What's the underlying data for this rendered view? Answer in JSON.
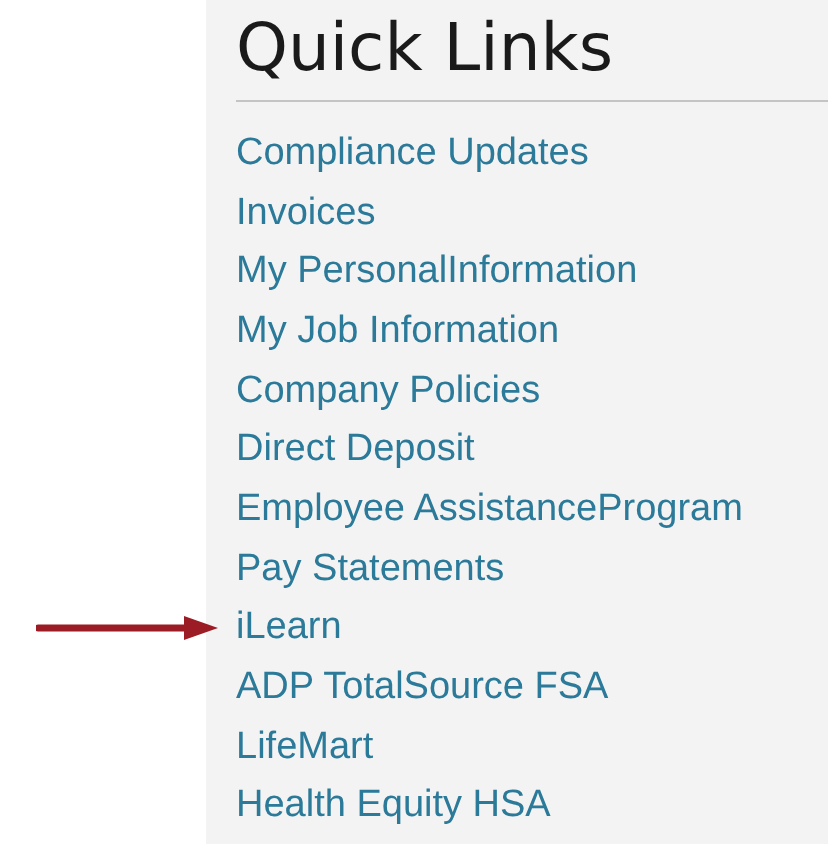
{
  "panel": {
    "title": "Quick Links",
    "links": [
      {
        "label": "Compliance Updates",
        "pointed_at": false
      },
      {
        "label": "Invoices",
        "pointed_at": false
      },
      {
        "label": "My PersonalInformation",
        "pointed_at": false
      },
      {
        "label": "My Job Information",
        "pointed_at": false
      },
      {
        "label": "Company Policies",
        "pointed_at": false
      },
      {
        "label": "Direct Deposit",
        "pointed_at": false
      },
      {
        "label": "Employee AssistanceProgram",
        "pointed_at": false
      },
      {
        "label": "Pay Statements",
        "pointed_at": false
      },
      {
        "label": "iLearn",
        "pointed_at": true
      },
      {
        "label": "ADP TotalSource FSA",
        "pointed_at": false
      },
      {
        "label": "LifeMart",
        "pointed_at": false
      },
      {
        "label": "Health Equity HSA",
        "pointed_at": false
      }
    ]
  }
}
